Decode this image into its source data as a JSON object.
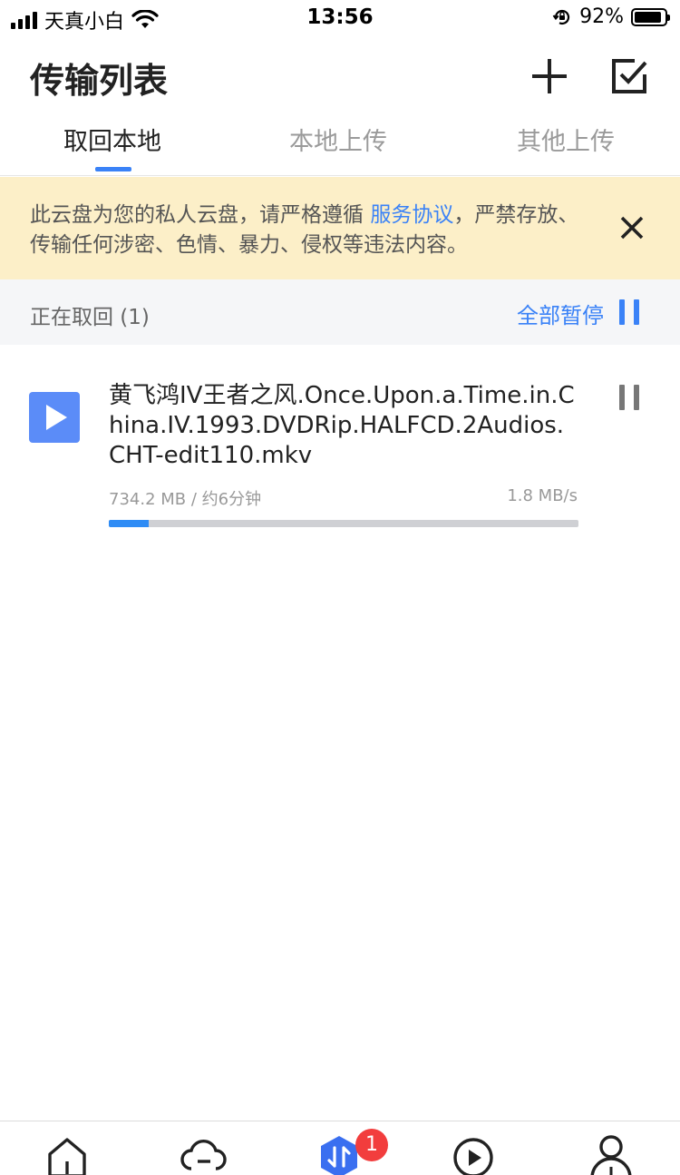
{
  "status_bar": {
    "carrier": "天真小白",
    "time": "13:56",
    "battery_percent": "92%",
    "battery_level": 0.92
  },
  "header": {
    "title": "传输列表",
    "add_icon": "plus-icon",
    "select_icon": "checkbox-icon"
  },
  "tabs": [
    {
      "label": "取回本地",
      "active": true
    },
    {
      "label": "本地上传",
      "active": false
    },
    {
      "label": "其他上传",
      "active": false
    }
  ],
  "notice": {
    "text_before": "此云盘为您的私人云盘，请严格遵循 ",
    "link": "服务协议",
    "text_after": "，严禁存放、传输任何涉密、色情、暴力、侵权等违法内容。"
  },
  "section": {
    "label": "正在取回 (1)",
    "pause_all": "全部暂停"
  },
  "transfer_item": {
    "name": "黄飞鸿IV王者之风.Once.Upon.a.Time.in.China.IV.1993.DVDRip.HALFCD.2Audios.CHT-edit110.mkv",
    "meta": "734.2 MB / 约6分钟",
    "speed": "1.8 MB/s",
    "progress": 0.085
  },
  "bottom_nav": {
    "items": [
      "home-icon",
      "cloud-icon",
      "transfer-icon",
      "play-icon",
      "profile-icon"
    ],
    "badge": "1"
  },
  "colors": {
    "accent": "#3a82f7",
    "notice_bg": "#fcefc8",
    "badge": "#f23d3d"
  }
}
